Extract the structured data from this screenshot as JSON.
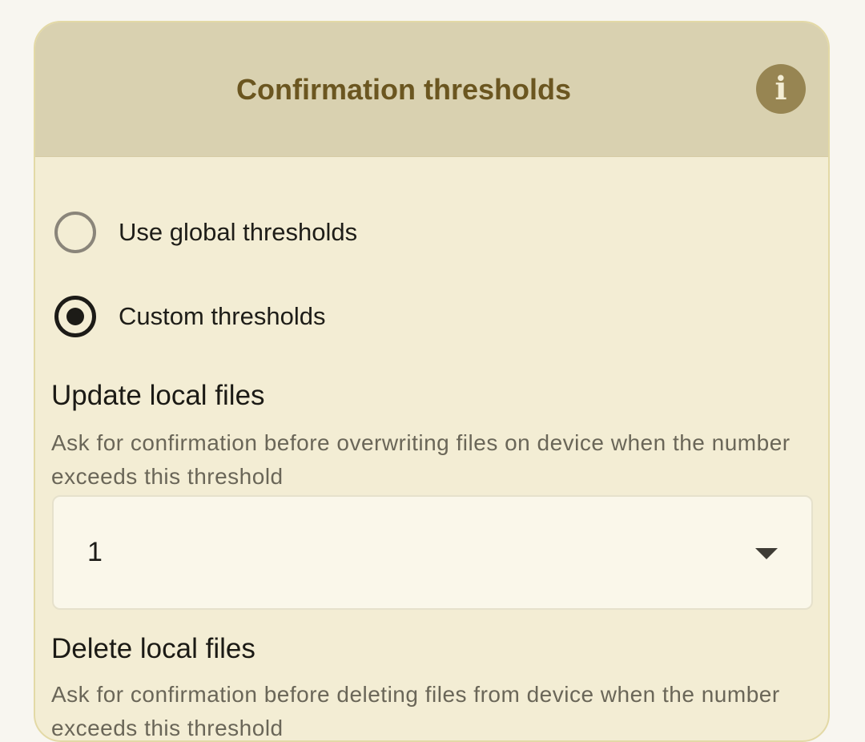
{
  "card": {
    "title": "Confirmation thresholds",
    "info_icon": "info-icon",
    "info_glyph": "i"
  },
  "threshold_mode": {
    "options": [
      {
        "label": "Use global thresholds",
        "selected": false
      },
      {
        "label": "Custom thresholds",
        "selected": true
      }
    ]
  },
  "update_local_files": {
    "title": "Update local files",
    "description": "Ask for confirmation before overwriting files on device when the number exceeds this threshold",
    "value": "1",
    "dropdown_icon": "chevron-down-icon"
  },
  "delete_local_files": {
    "title": "Delete local files",
    "description": "Ask for confirmation before deleting files from device when the number exceeds this threshold"
  },
  "colors": {
    "page_background": "#f8f6f0",
    "card_background": "#f3edd4",
    "header_background": "#d9d1b0",
    "title_color": "#6b5620",
    "info_button": "#978552"
  }
}
